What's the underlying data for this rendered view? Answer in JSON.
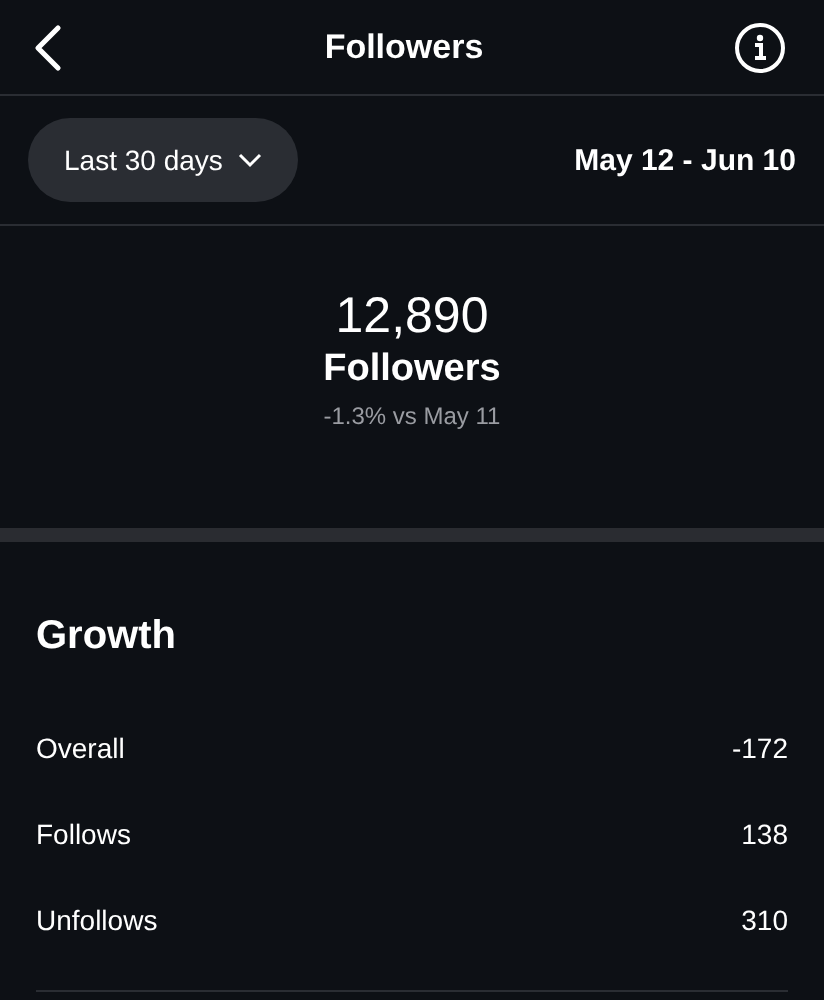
{
  "header": {
    "title": "Followers"
  },
  "filter": {
    "range": "Last 30 days",
    "dates": "May 12 - Jun 10"
  },
  "summary": {
    "count": "12,890",
    "label": "Followers",
    "change": "-1.3% vs May 11"
  },
  "growth": {
    "title": "Growth",
    "rows": [
      {
        "label": "Overall",
        "value": "-172"
      },
      {
        "label": "Follows",
        "value": "138"
      },
      {
        "label": "Unfollows",
        "value": "310"
      }
    ]
  }
}
